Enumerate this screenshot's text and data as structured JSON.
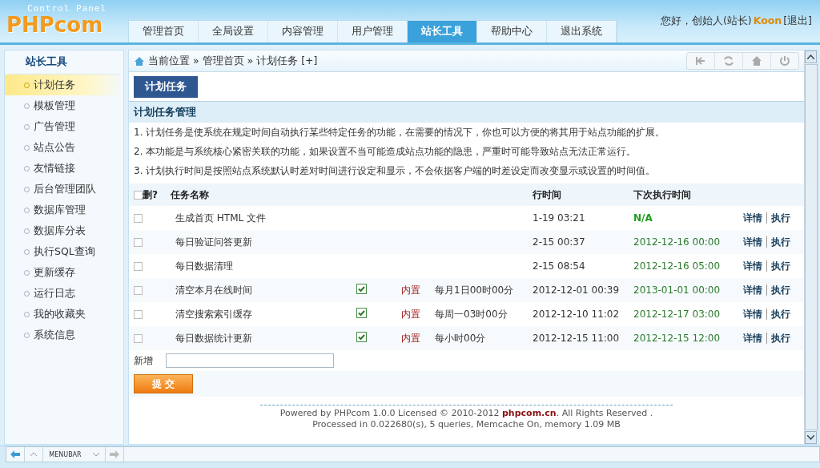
{
  "header": {
    "subtitle": "Control Panel",
    "logo": "PHPcom",
    "tabs": [
      {
        "label": "管理首页",
        "selected": false
      },
      {
        "label": "全局设置",
        "selected": false
      },
      {
        "label": "内容管理",
        "selected": false
      },
      {
        "label": "用户管理",
        "selected": false
      },
      {
        "label": "站长工具",
        "selected": true
      },
      {
        "label": "帮助中心",
        "selected": false
      },
      {
        "label": "退出系统",
        "selected": false
      }
    ],
    "greeting": "您好，创始人(站长)",
    "user": "Koon",
    "logout": "[退出]"
  },
  "sidebar": {
    "title": "站长工具",
    "items": [
      {
        "label": "计划任务",
        "selected": true
      },
      {
        "label": "模板管理",
        "selected": false
      },
      {
        "label": "广告管理",
        "selected": false
      },
      {
        "label": "站点公告",
        "selected": false
      },
      {
        "label": "友情链接",
        "selected": false
      },
      {
        "label": "后台管理团队",
        "selected": false
      },
      {
        "label": "数据库管理",
        "selected": false
      },
      {
        "label": "数据库分表",
        "selected": false
      },
      {
        "label": "执行SQL查询",
        "selected": false
      },
      {
        "label": "更新缓存",
        "selected": false
      },
      {
        "label": "运行日志",
        "selected": false
      },
      {
        "label": "我的收藏夹",
        "selected": false
      },
      {
        "label": "系统信息",
        "selected": false
      }
    ]
  },
  "breadcrumb": "当前位置 » 管理首页 » 计划任务 [+]",
  "page_tab": "计划任务",
  "section_title": "计划任务管理",
  "notes": [
    "1. 计划任务是使系统在规定时间自动执行某些特定任务的功能，在需要的情况下，你也可以方便的将其用于站点功能的扩展。",
    "2. 本功能是与系统核心紧密关联的功能，如果设置不当可能造成站点功能的隐患，严重时可能导致站点无法正常运行。",
    "3. 计划执行时间是按照站点系统默认时差对时间进行设定和显示，不会依据客户端的时差设定而改变显示或设置的时间值。"
  ],
  "table": {
    "select_all": {
      "label": "删?",
      "checked": false
    },
    "header": {
      "name": "任务名称",
      "last_run": "行时间",
      "next_run": "下次执行时间"
    },
    "rows": [
      {
        "selected": false,
        "name": "生成首页 HTML 文件",
        "last_run": "1-19 03:21",
        "next_pending": true,
        "next_run": "N/A",
        "actions": [
          "详情",
          "执行"
        ]
      },
      {
        "selected": false,
        "name": "每日验证问答更新",
        "last_run": "2-15 00:37",
        "next_pending": false,
        "next_run": "2012-12-16 00:00",
        "actions": [
          "详情",
          "执行"
        ]
      },
      {
        "selected": false,
        "name": "每日数据清理",
        "last_run": "2-15 08:54",
        "next_pending": false,
        "next_run": "2012-12-16 05:00",
        "actions": [
          "详情",
          "执行"
        ]
      },
      {
        "selected": false,
        "name": "清空本月在线时间",
        "enabled": true,
        "type": "内置",
        "period": "每月1日00时00分",
        "last_run": "2012-12-01 00:39",
        "next_pending": false,
        "next_run": "2013-01-01 00:00",
        "actions": [
          "详情",
          "执行"
        ]
      },
      {
        "selected": false,
        "name": "清空搜索索引缓存",
        "enabled": true,
        "type": "内置",
        "period": "每周一03时00分",
        "last_run": "2012-12-10 11:02",
        "next_pending": false,
        "next_run": "2012-12-17 03:00",
        "actions": [
          "详情",
          "执行"
        ]
      },
      {
        "selected": false,
        "name": "每日数据统计更新",
        "enabled": true,
        "type": "内置",
        "period": "每小时00分",
        "last_run": "2012-12-15 11:00",
        "next_pending": false,
        "next_run": "2012-12-15 12:00",
        "actions": [
          "详情",
          "执行"
        ]
      }
    ]
  },
  "add": {
    "label": "新增"
  },
  "submit": "提 交",
  "footer": [
    "Powered by PHPcom 1.0.0 Licensed © 2010-2012 **phpcom.cn**. All Rights Reserved .",
    "Processed in 0.022680(s), 5 queries, Memcache On, memory 1.09 MB"
  ],
  "bottom_bar": {
    "label": "MENUBAR"
  }
}
